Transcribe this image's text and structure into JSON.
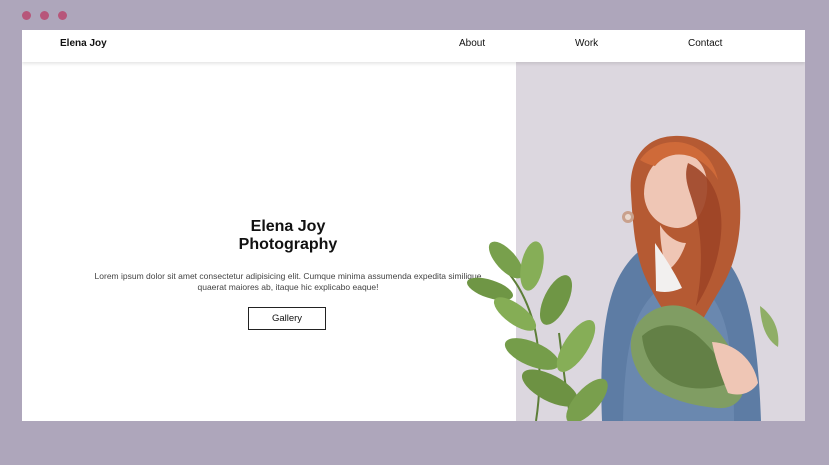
{
  "window": {
    "controls": [
      "close-dot",
      "minimize-dot",
      "maximize-dot"
    ],
    "dot_color": "#b7567a",
    "background": "#aea6bb"
  },
  "header": {
    "brand": "Elena Joy",
    "nav": {
      "about": "About",
      "work": "Work",
      "contact": "Contact"
    }
  },
  "hero": {
    "title_line1": "Elena Joy",
    "title_line2": "Photography",
    "description": "Lorem ipsum dolor sit amet consectetur adipisicing elit. Cumque minima assumenda expedita similique quaerat maiores ab, itaque hic explicabo eaque!",
    "button": "Gallery"
  },
  "image": {
    "subject": "woman-with-red-hair-holding-greenery",
    "background": "#dcd7df"
  }
}
